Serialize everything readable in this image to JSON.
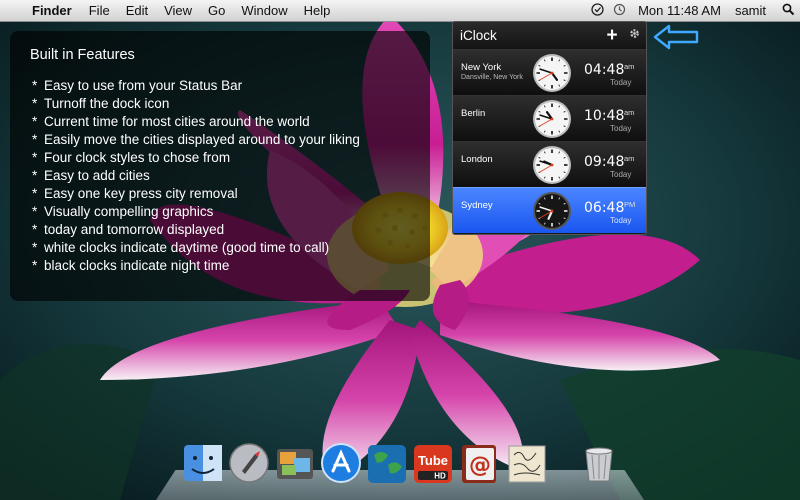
{
  "menubar": {
    "apple_glyph": "",
    "app_name": "Finder",
    "menus": [
      "File",
      "Edit",
      "View",
      "Go",
      "Window",
      "Help"
    ],
    "clock": "Mon 11:48 AM",
    "user": "samit",
    "status_icons": [
      "iclock-status-icon",
      "time-machine-icon"
    ]
  },
  "features": {
    "title": "Built in Features",
    "bullet": "*",
    "items": [
      "Easy to use from your Status Bar",
      "Turnoff the dock icon",
      "Current time for most cities around the world",
      "Easily move the cities displayed around to your liking",
      "Four clock styles to chose from",
      "Easy to add cities",
      "Easy one key press city removal",
      "Visually compelling graphics",
      "today and tomorrow displayed",
      "white clocks indicate daytime (good time to call)",
      "black clocks indicate night time"
    ]
  },
  "iclock": {
    "title": "iClock",
    "add_label": "+",
    "cities": [
      {
        "city": "New York",
        "subtitle": "Dansville, New York",
        "time": "04:48",
        "ampm": "am",
        "day": "Today",
        "hour": 4,
        "minute": 48,
        "second": 40,
        "clock_style": "white",
        "selected": false
      },
      {
        "city": "Berlin",
        "subtitle": "",
        "time": "10:48",
        "ampm": "am",
        "day": "Today",
        "hour": 10,
        "minute": 48,
        "second": 40,
        "clock_style": "white",
        "selected": false
      },
      {
        "city": "London",
        "subtitle": "",
        "time": "09:48",
        "ampm": "am",
        "day": "Today",
        "hour": 9,
        "minute": 48,
        "second": 40,
        "clock_style": "white",
        "selected": false
      },
      {
        "city": "Sydney",
        "subtitle": "",
        "time": "06:48",
        "ampm": "PM",
        "day": "Today",
        "hour": 6,
        "minute": 48,
        "second": 40,
        "clock_style": "black",
        "selected": true
      }
    ]
  },
  "dock": {
    "apps": [
      "finder-icon",
      "launchpad-rocket-icon",
      "iphoto-icon",
      "app-store-icon",
      "world-map-icon",
      "tube-hd-icon",
      "mail-icon",
      "signature-document-icon",
      "trash-icon"
    ],
    "tube_label": "Tube",
    "tube_badge": "HD",
    "mail_glyph": "@"
  },
  "colors": {
    "selected_row": "#2a66f5",
    "arrow": "#3fa9ff",
    "second_hand": "#e23b1a",
    "flower": "#c81e94"
  }
}
